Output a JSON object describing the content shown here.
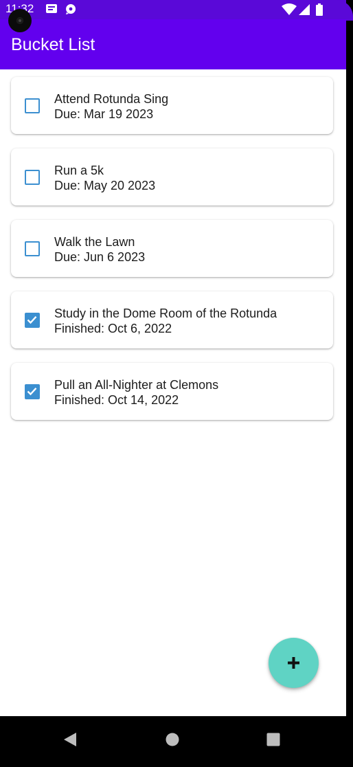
{
  "status_bar": {
    "time": "11:32",
    "icons": [
      "camera-cutout",
      "notification-icon",
      "assistant-icon",
      "wifi-icon",
      "signal-icon",
      "battery-icon"
    ]
  },
  "app_bar": {
    "title": "Bucket List"
  },
  "items": [
    {
      "title": "Attend Rotunda Sing",
      "subtitle": "Due: Mar 19 2023",
      "checked": false
    },
    {
      "title": "Run a 5k",
      "subtitle": "Due: May 20 2023",
      "checked": false
    },
    {
      "title": "Walk the Lawn",
      "subtitle": "Due: Jun 6 2023",
      "checked": false
    },
    {
      "title": "Study in the Dome Room of the Rotunda",
      "subtitle": "Finished: Oct 6, 2022",
      "checked": true
    },
    {
      "title": "Pull an All-Nighter at Clemons",
      "subtitle": "Finished: Oct 14, 2022",
      "checked": true
    }
  ],
  "fab": {
    "icon": "plus-icon"
  },
  "nav_bar": {
    "buttons": [
      "back-icon",
      "home-icon",
      "recents-icon"
    ]
  },
  "colors": {
    "app_bar": "#6200ee",
    "status_bar": "#5a09d8",
    "checkbox": "#3b8fd0",
    "fab": "#5fd3c4"
  }
}
